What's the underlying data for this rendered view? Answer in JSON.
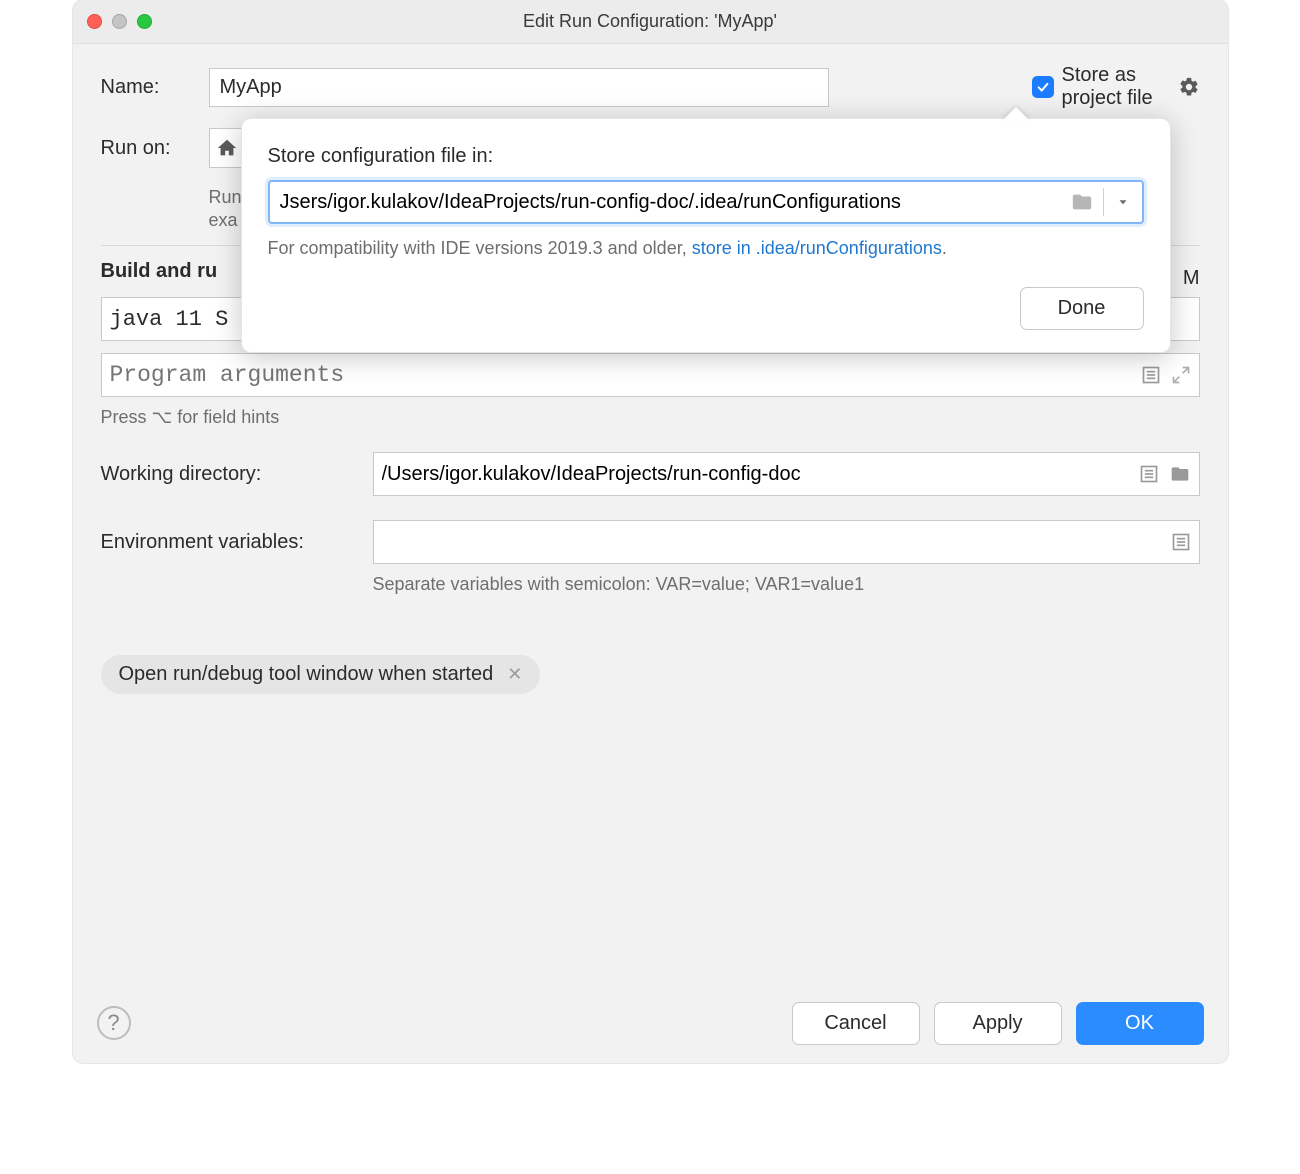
{
  "window": {
    "title": "Edit Run Configuration: 'MyApp'"
  },
  "name": {
    "label": "Name:",
    "value": "MyApp"
  },
  "store_checkbox": {
    "label": "Store as project file",
    "checked": true
  },
  "run_on": {
    "label": "Run on:"
  },
  "run_on_hint": {
    "line1": "Run",
    "line2": "exa"
  },
  "section": {
    "build_and_run": "Build and ru"
  },
  "sdk": {
    "value": "java 11 S"
  },
  "partial_right": "M",
  "program_args": {
    "placeholder": "Program arguments",
    "value": ""
  },
  "field_hints": "Press ⌥ for field hints",
  "working_dir": {
    "label": "Working directory:",
    "value": "/Users/igor.kulakov/IdeaProjects/run-config-doc"
  },
  "env_vars": {
    "label": "Environment variables:",
    "value": "",
    "hint": "Separate variables with semicolon: VAR=value; VAR1=value1"
  },
  "chip": {
    "label": "Open run/debug tool window when started"
  },
  "buttons": {
    "cancel": "Cancel",
    "apply": "Apply",
    "ok": "OK"
  },
  "popover": {
    "title": "Store configuration file in:",
    "path": "Jsers/igor.kulakov/IdeaProjects/run-config-doc/.idea/runConfigurations",
    "compat_prefix": "For compatibility with IDE versions 2019.3 and older, ",
    "compat_link": "store in .idea/runConfigurations",
    "compat_suffix": ".",
    "done": "Done"
  }
}
